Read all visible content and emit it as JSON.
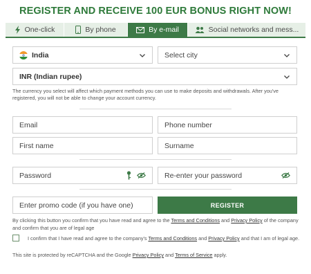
{
  "header": {
    "title": "REGISTER AND RECEIVE 100 EUR BONUS RIGHT NOW!"
  },
  "tabs": [
    {
      "label": "One-click",
      "icon": "lightning-icon"
    },
    {
      "label": "By phone",
      "icon": "phone-icon"
    },
    {
      "label": "By e-mail",
      "icon": "envelope-icon"
    },
    {
      "label": "Social networks and mess...",
      "icon": "people-icon"
    }
  ],
  "form": {
    "country": "India",
    "city_placeholder": "Select city",
    "currency": "INR (Indian rupee)",
    "currency_note": "The currency you select will affect which payment methods you can use to make deposits and withdrawals. After you've registered, you will not be able to change your account currency.",
    "email_placeholder": "Email",
    "phone_placeholder": "Phone number",
    "first_name_placeholder": "First name",
    "surname_placeholder": "Surname",
    "password_placeholder": "Password",
    "repassword_placeholder": "Re-enter your password",
    "promo_placeholder": "Enter promo code (if you have one)",
    "register_label": "REGISTER"
  },
  "terms": {
    "line1_pre": "By clicking this button you confirm that you have read and agree to the ",
    "terms_link": "Terms and Conditions",
    "and": " and ",
    "privacy_link": "Privacy Policy",
    "line1_post": " of the company and confirm that you are of legal age",
    "checkbox_pre": "I confirm that I have read and agree to the company's ",
    "checkbox_terms": "Terms and Conditions",
    "checkbox_and": " and ",
    "checkbox_privacy": "Privacy Policy",
    "checkbox_post": " and that I am of legal age.",
    "recaptcha_pre": "This site is protected by reCAPTCHA and the Google ",
    "recaptcha_privacy": "Privacy Policy",
    "recaptcha_and": " and ",
    "recaptcha_tos": "Terms of Service",
    "recaptcha_post": " apply."
  },
  "colors": {
    "accent": "#3d7a47",
    "header": "#2e7a3a",
    "tab_bg": "#e6efe6"
  }
}
